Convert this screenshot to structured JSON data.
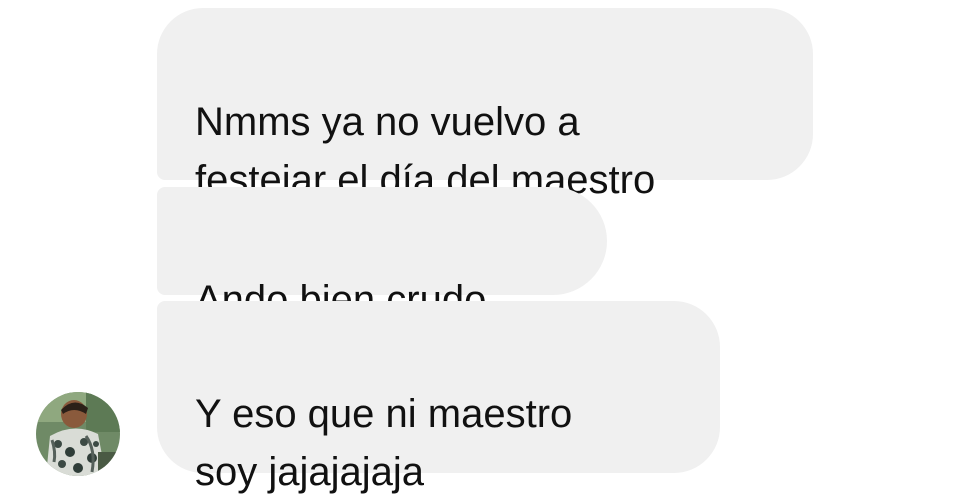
{
  "conversation": {
    "messages": [
      {
        "text": "Nmms ya no vuelvo a\nfestejar el día del maestro"
      },
      {
        "text": "Ando bien crudo"
      },
      {
        "text": "Y eso que ni maestro\nsoy jajajajaja"
      }
    ],
    "sender": {
      "avatar_icon": "user-photo-avatar"
    }
  },
  "colors": {
    "bubble_background": "#f0f0f0",
    "text": "#111111",
    "page_background": "#ffffff"
  }
}
